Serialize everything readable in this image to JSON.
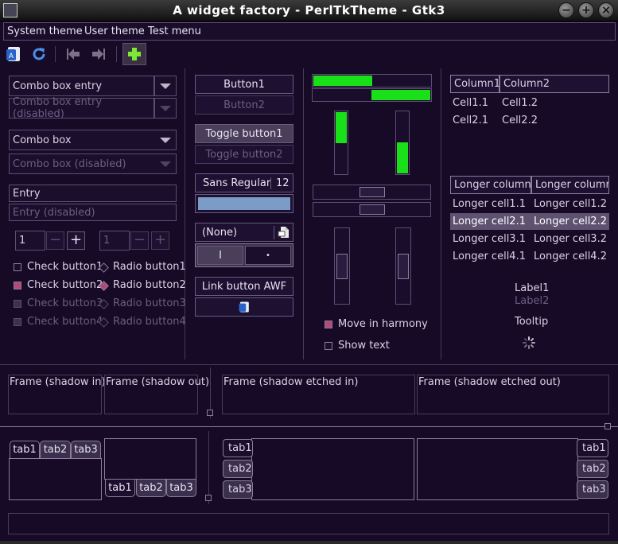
{
  "window": {
    "title": "A widget factory - PerlTkTheme - Gtk3",
    "minimize_glyph": "−",
    "maximize_glyph": "+",
    "close_glyph": "×"
  },
  "menubar": {
    "items": [
      "System theme",
      "User theme",
      "Test menu"
    ]
  },
  "toolbar": {
    "icons": [
      "application-icon",
      "refresh-icon",
      "go-first-icon",
      "go-last-icon",
      "add-icon"
    ],
    "add_color": "#7de835"
  },
  "col1": {
    "combo_entry": "Combo box entry",
    "combo_entry_disabled": "Combo box entry (disabled)",
    "combo_box": "Combo box",
    "combo_box_disabled": "Combo box (disabled)",
    "entry": "Entry",
    "entry_disabled": "Entry (disabled)",
    "spin1_value": "1",
    "spin2_value": "1",
    "spin_minus": "−",
    "spin_plus": "+",
    "checks": [
      "Check button1",
      "Check button2",
      "Check button3",
      "Check button4"
    ],
    "radios": [
      "Radio button1",
      "Radio button2",
      "Radio button3",
      "Radio button4"
    ]
  },
  "col2": {
    "button1": "Button1",
    "button2": "Button2",
    "toggle1": "Toggle button1",
    "toggle2": "Toggle button2",
    "font_name": "Sans Regular",
    "font_size": "12",
    "color_swatch": "#7a9cc6",
    "file_chooser": "(None)",
    "switch_on": "I",
    "switch_off": "•",
    "link_button": "Link button AWF"
  },
  "col3": {
    "progress_h1": 0.5,
    "progress_h2": 0.5,
    "progress_v1": 0.5,
    "progress_v2": 0.5,
    "move_in_harmony": "Move in harmony",
    "show_text": "Show text"
  },
  "col4": {
    "tree1_headers": [
      "Column1",
      "Column2"
    ],
    "tree1_rows": [
      [
        "Cell1.1",
        "Cell1.2"
      ],
      [
        "Cell2.1",
        "Cell2.2"
      ]
    ],
    "tree2_headers": [
      "Longer column1",
      "Longer column2"
    ],
    "tree2_rows": [
      [
        "Longer cell1.1",
        "Longer cell1.2"
      ],
      [
        "Longer cell2.1",
        "Longer cell2.2"
      ],
      [
        "Longer cell3.1",
        "Longer cell3.2"
      ],
      [
        "Longer cell4.1",
        "Longer cell4.2"
      ]
    ],
    "label1": "Label1",
    "label2": "Label2",
    "tooltip": "Tooltip"
  },
  "frames": [
    "Frame (shadow in)",
    "Frame (shadow out)",
    "Frame (shadow etched in)",
    "Frame (shadow etched out)"
  ],
  "notebooks": {
    "tabs": [
      "tab1",
      "tab2",
      "tab3"
    ]
  },
  "colors": {
    "accent": "#b04a78",
    "progress": "#19e019",
    "background": "#160a26"
  }
}
